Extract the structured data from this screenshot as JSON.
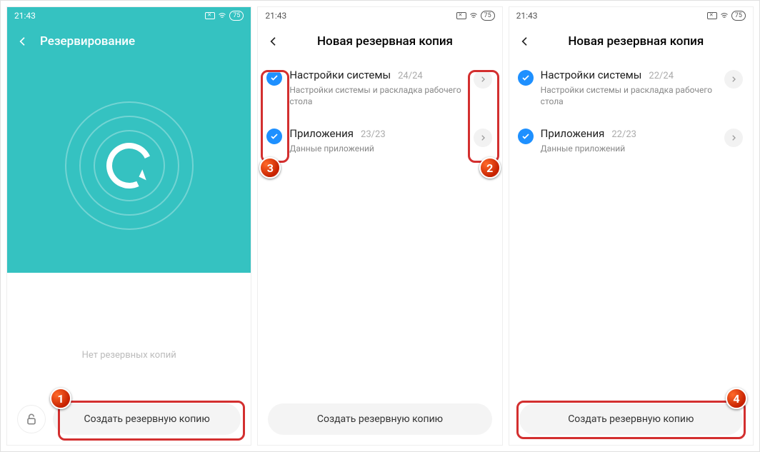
{
  "status": {
    "time": "21:43",
    "battery": "75"
  },
  "screen1": {
    "title": "Резервирование",
    "empty": "Нет резервных копий",
    "create": "Создать резервную копию"
  },
  "screen2": {
    "title": "Новая резервная копия",
    "item1": {
      "title": "Настройки системы",
      "count": "24/24",
      "sub": "Настройки системы и раскладка рабочего стола"
    },
    "item2": {
      "title": "Приложения",
      "count": "23/23",
      "sub": "Данные приложений"
    },
    "create": "Создать резервную копию"
  },
  "screen3": {
    "title": "Новая резервная копия",
    "item1": {
      "title": "Настройки системы",
      "count": "22/24",
      "sub": "Настройки системы и раскладка рабочего стола"
    },
    "item2": {
      "title": "Приложения",
      "count": "22/23",
      "sub": "Данные приложений"
    },
    "create": "Создать резервную копию"
  },
  "badges": {
    "b1": "1",
    "b2": "2",
    "b3": "3",
    "b4": "4"
  }
}
